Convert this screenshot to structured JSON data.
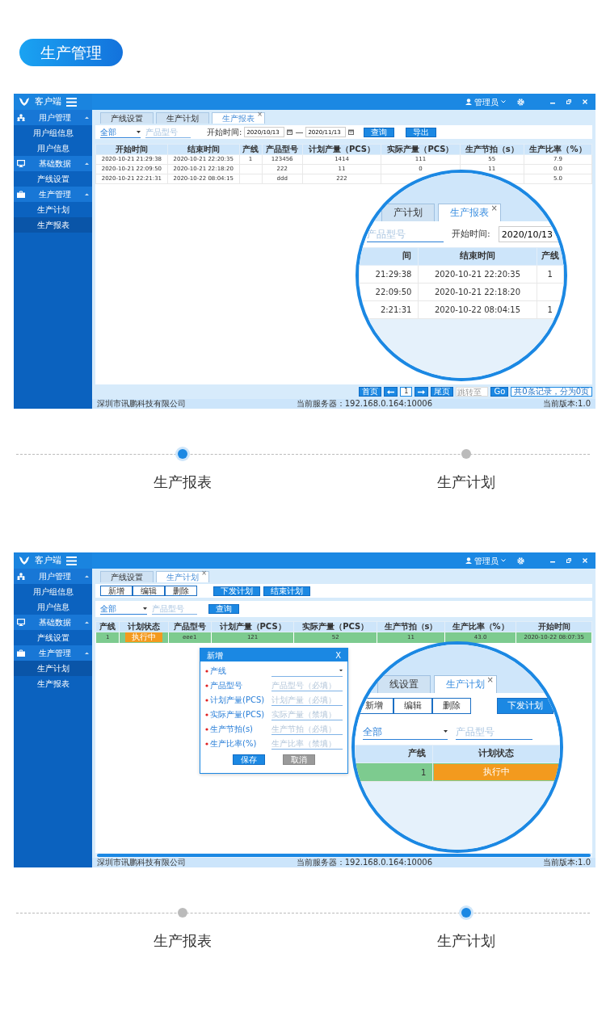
{
  "header": {
    "title": "生产管理"
  },
  "sections": [
    {
      "kind": "report",
      "app": {
        "brand": "客户端",
        "user": "管理员",
        "sidebar": [
          {
            "label": "用户管理",
            "expanded": true,
            "children": [
              {
                "label": "用户组信息",
                "selected": false
              },
              {
                "label": "用户信息",
                "selected": false
              }
            ]
          },
          {
            "label": "基础数据",
            "expanded": true,
            "children": [
              {
                "label": "产线设置",
                "selected": false
              }
            ]
          },
          {
            "label": "生产管理",
            "expanded": true,
            "children": [
              {
                "label": "生产计划",
                "selected": false
              },
              {
                "label": "生产报表",
                "selected": true
              }
            ]
          }
        ],
        "tabs": [
          {
            "label": "产线设置",
            "selected": false
          },
          {
            "label": "生产计划",
            "selected": false
          },
          {
            "label": "生产报表",
            "selected": true,
            "close": "×"
          }
        ],
        "main": {
          "filter": {
            "select": "全部",
            "product_placeholder": "产品型号",
            "start_label": "开始时间:",
            "start_date": "2020/10/13",
            "separator": "—",
            "end_date": "2020/11/13",
            "buttons": [
              "查询",
              "导出"
            ]
          },
          "table": {
            "columns": [
              "开始时间",
              "结束时间",
              "产线",
              "产品型号",
              "计划产量（PCS）",
              "实际产量（PCS）",
              "生产节拍（s）",
              "生产比率（%）"
            ],
            "rows": [
              {
                "selected": false,
                "cells": [
                  "2020-10-21 21:29:38",
                  "2020-10-21 22:20:35",
                  "1",
                  "123456",
                  "1414",
                  "111",
                  "55",
                  "7.9"
                ]
              },
              {
                "selected": false,
                "cells": [
                  "2020-10-21 22:09:50",
                  "2020-10-21 22:18:20",
                  null,
                  "222",
                  "11",
                  "0",
                  "11",
                  "0.0"
                ]
              },
              {
                "selected": false,
                "cells": [
                  "2020-10-21 22:21:31",
                  "2020-10-22 08:04:15",
                  null,
                  "ddd",
                  "222",
                  null,
                  null,
                  "5.0"
                ]
              }
            ]
          },
          "pagination": {
            "first": "首页",
            "page": "1",
            "last": "尾页",
            "jump_placeholder": "跳转至",
            "go": "Go",
            "summary": "共0条记录，分为0页"
          }
        },
        "status_bar": {
          "company": "深圳市讯鹏科技有限公司",
          "server": "当前服务器：192.168.0.164:10006",
          "version": "当前版本:1.0"
        }
      },
      "magnifier": {
        "tabs": [
          {
            "label": "产计划",
            "selected": false
          },
          {
            "label": "生产报表",
            "selected": true,
            "close": "×"
          }
        ],
        "filter": {
          "product_placeholder": "产品型号",
          "start_label": "开始时间:",
          "start_date": "2020/10/13"
        },
        "table": {
          "columns": [
            "间",
            "结束时间",
            "产线"
          ],
          "rows": [
            {
              "selected": false,
              "cells": [
                "21:29:38",
                "2020-10-21 22:20:35",
                "1"
              ]
            },
            {
              "selected": false,
              "cells": [
                "22:09:50",
                "2020-10-21 22:18:20",
                null
              ]
            },
            {
              "selected": false,
              "cells": [
                "2:21:31",
                "2020-10-22 08:04:15",
                "1"
              ]
            }
          ]
        }
      },
      "timeline": [
        {
          "label": "生产报表",
          "selected": true
        },
        {
          "label": "生产计划",
          "selected": false
        }
      ]
    },
    {
      "kind": "plan",
      "app": {
        "brand": "客户端",
        "user": "管理员",
        "sidebar": [
          {
            "label": "用户管理",
            "expanded": true,
            "children": [
              {
                "label": "用户组信息",
                "selected": false
              },
              {
                "label": "用户信息",
                "selected": false
              }
            ]
          },
          {
            "label": "基础数据",
            "expanded": true,
            "children": [
              {
                "label": "产线设置",
                "selected": false
              }
            ]
          },
          {
            "label": "生产管理",
            "expanded": true,
            "children": [
              {
                "label": "生产计划",
                "selected": true
              },
              {
                "label": "生产报表",
                "selected": false
              }
            ]
          }
        ],
        "tabs": [
          {
            "label": "产线设置",
            "selected": false
          },
          {
            "label": "生产计划",
            "selected": true,
            "close": "×"
          }
        ],
        "main": {
          "action_buttons": [
            {
              "label": "新增",
              "kind": "outline"
            },
            {
              "label": "编辑",
              "kind": "outline"
            },
            {
              "label": "删除",
              "kind": "outline"
            },
            {
              "label": "下发计划",
              "kind": "primary"
            },
            {
              "label": "结束计划",
              "kind": "primary"
            }
          ],
          "filter": {
            "select": "全部",
            "product_placeholder": "产品型号",
            "buttons": [
              "查询"
            ]
          },
          "table": {
            "columns": [
              "产线",
              "计划状态",
              "产品型号",
              "计划产量（PCS）",
              "实际产量（PCS）",
              "生产节拍（s）",
              "生产比率（%）",
              "开始时间"
            ],
            "rows": [
              {
                "selected": true,
                "cells": [
                  "1",
                  {
                    "kind": "badge",
                    "text": "执行中"
                  },
                  "eee1",
                  "121",
                  "52",
                  "11",
                  "43.0",
                  "2020-10-22 08:07:35"
                ]
              }
            ]
          },
          "dialog": {
            "title": "新增",
            "close": "X",
            "fields": [
              {
                "label": "产线",
                "required": true,
                "kind": "select"
              },
              {
                "label": "产品型号",
                "required": true,
                "kind": "text",
                "placeholder": "产品型号（必填）"
              },
              {
                "label": "计划产量(PCS)",
                "required": true,
                "kind": "text",
                "placeholder": "计划产量（必填）"
              },
              {
                "label": "实际产量(PCS)",
                "required": true,
                "kind": "text",
                "placeholder": "实际产量（禁填）"
              },
              {
                "label": "生产节拍(s)",
                "required": true,
                "kind": "text",
                "placeholder": "生产节拍（必填）"
              },
              {
                "label": "生产比率(%)",
                "required": true,
                "kind": "text",
                "placeholder": "生产比率（禁填）"
              }
            ],
            "buttons": [
              {
                "label": "保存",
                "kind": "primary"
              },
              {
                "label": "取消",
                "kind": "secondary"
              }
            ]
          }
        },
        "status_bar": {
          "company": "深圳市讯鹏科技有限公司",
          "server": "当前服务器：192.168.0.164:10006",
          "version": "当前版本:1.0"
        }
      },
      "magnifier": {
        "tabs": [
          {
            "label": "线设置",
            "selected": false
          },
          {
            "label": "生产计划",
            "selected": true,
            "close": "×"
          }
        ],
        "action_buttons": [
          {
            "label": "新增",
            "kind": "outline"
          },
          {
            "label": "编辑",
            "kind": "outline"
          },
          {
            "label": "删除",
            "kind": "outline"
          },
          {
            "label": "下发计划",
            "kind": "primary"
          }
        ],
        "filter": {
          "select": "全部",
          "product_placeholder": "产品型号"
        },
        "table": {
          "columns": [
            "产线",
            "计划状态"
          ],
          "rows": [
            {
              "selected": true,
              "cells": [
                "1",
                {
                  "kind": "badge",
                  "text": "执行中"
                }
              ]
            }
          ]
        }
      },
      "timeline": [
        {
          "label": "生产报表",
          "selected": false
        },
        {
          "label": "生产计划",
          "selected": true
        }
      ]
    }
  ]
}
